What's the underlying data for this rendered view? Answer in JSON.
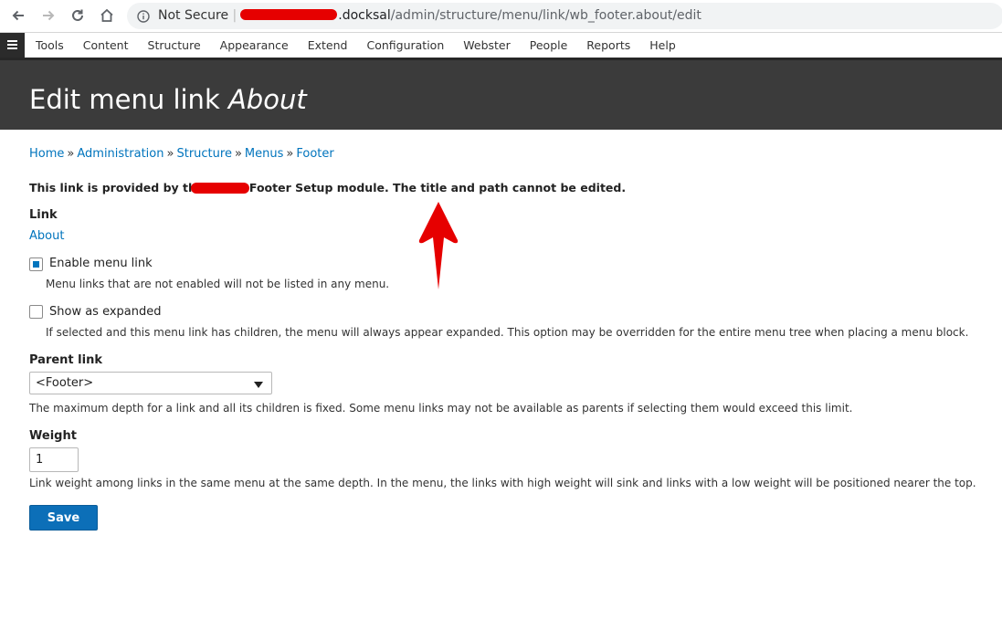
{
  "browser": {
    "security_label": "Not Secure",
    "url_host_suffix": ".docksal",
    "url_path": "/admin/structure/menu/link/wb_footer.about/edit"
  },
  "toolbar": {
    "items": [
      "Tools",
      "Content",
      "Structure",
      "Appearance",
      "Extend",
      "Configuration",
      "Webster",
      "People",
      "Reports",
      "Help"
    ]
  },
  "header": {
    "title_prefix": "Edit menu link ",
    "title_emphasis": "About"
  },
  "breadcrumb": {
    "items": [
      "Home",
      "Administration",
      "Structure",
      "Menus",
      "Footer"
    ],
    "separator": "»"
  },
  "notice": {
    "before": "This link is provided by th",
    "after": "Footer Setup module. The title and path cannot be edited."
  },
  "link_field": {
    "label": "Link",
    "value": "About"
  },
  "enable": {
    "checked": true,
    "label": "Enable menu link",
    "description": "Menu links that are not enabled will not be listed in any menu."
  },
  "expanded": {
    "checked": false,
    "label": "Show as expanded",
    "description": "If selected and this menu link has children, the menu will always appear expanded. This option may be overridden for the entire menu tree when placing a menu block."
  },
  "parent": {
    "label": "Parent link",
    "selected": "<Footer>",
    "description": "The maximum depth for a link and all its children is fixed. Some menu links may not be available as parents if selecting them would exceed this limit."
  },
  "weight": {
    "label": "Weight",
    "value": "1",
    "description": "Link weight among links in the same menu at the same depth. In the menu, the links with high weight will sink and links with a low weight will be positioned nearer the top."
  },
  "save_label": "Save",
  "colors": {
    "link": "#0074bd",
    "header_bg": "#3b3b3b",
    "button_bg": "#0c6fb8",
    "annotation": "#e60000"
  }
}
